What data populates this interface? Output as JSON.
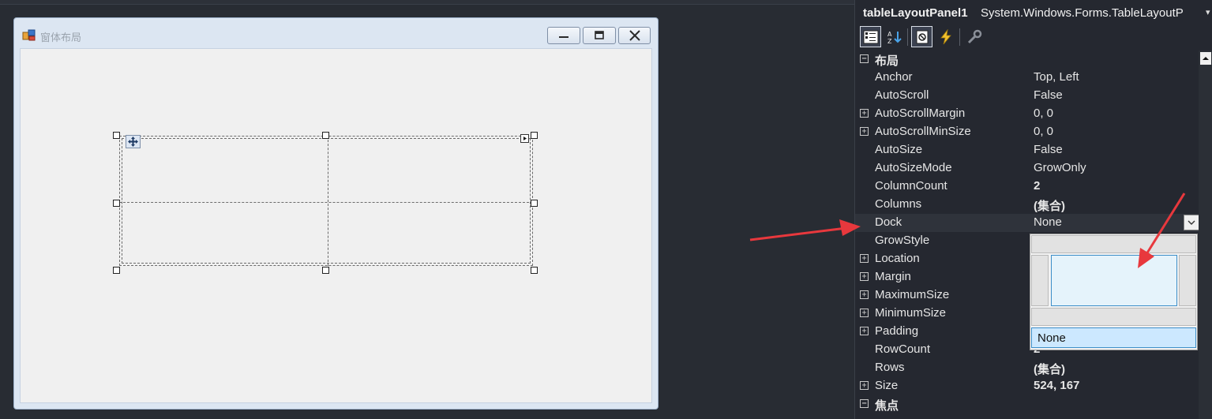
{
  "form": {
    "title": "窗体布局"
  },
  "properties_panel": {
    "object_name": "tableLayoutPanel1",
    "object_type": "System.Windows.Forms.TableLayoutP",
    "categories": {
      "layout": "布局",
      "focus": "焦点"
    },
    "rows": [
      {
        "name": "Anchor",
        "value": "Top, Left"
      },
      {
        "name": "AutoScroll",
        "value": "False"
      },
      {
        "name": "AutoScrollMargin",
        "value": "0, 0"
      },
      {
        "name": "AutoScrollMinSize",
        "value": "0, 0"
      },
      {
        "name": "AutoSize",
        "value": "False"
      },
      {
        "name": "AutoSizeMode",
        "value": "GrowOnly"
      },
      {
        "name": "ColumnCount",
        "value": "2"
      },
      {
        "name": "Columns",
        "value": "(集合)"
      },
      {
        "name": "Dock",
        "value": "None"
      },
      {
        "name": "GrowStyle",
        "value": ""
      },
      {
        "name": "Location",
        "value": ""
      },
      {
        "name": "Margin",
        "value": ""
      },
      {
        "name": "MaximumSize",
        "value": ""
      },
      {
        "name": "MinimumSize",
        "value": ""
      },
      {
        "name": "Padding",
        "value": ""
      },
      {
        "name": "RowCount",
        "value": "2"
      },
      {
        "name": "Rows",
        "value": "(集合)"
      },
      {
        "name": "Size",
        "value": "524, 167"
      }
    ],
    "dock_editor": {
      "none_label": "None"
    }
  },
  "colors": {
    "arrow": "#e8383d",
    "selection_blue": "#3d8fc9"
  },
  "icons": {
    "toolbar": [
      "categorized-icon",
      "alphabetical-icon",
      "properties-icon",
      "events-icon",
      "property-pages-icon"
    ]
  }
}
